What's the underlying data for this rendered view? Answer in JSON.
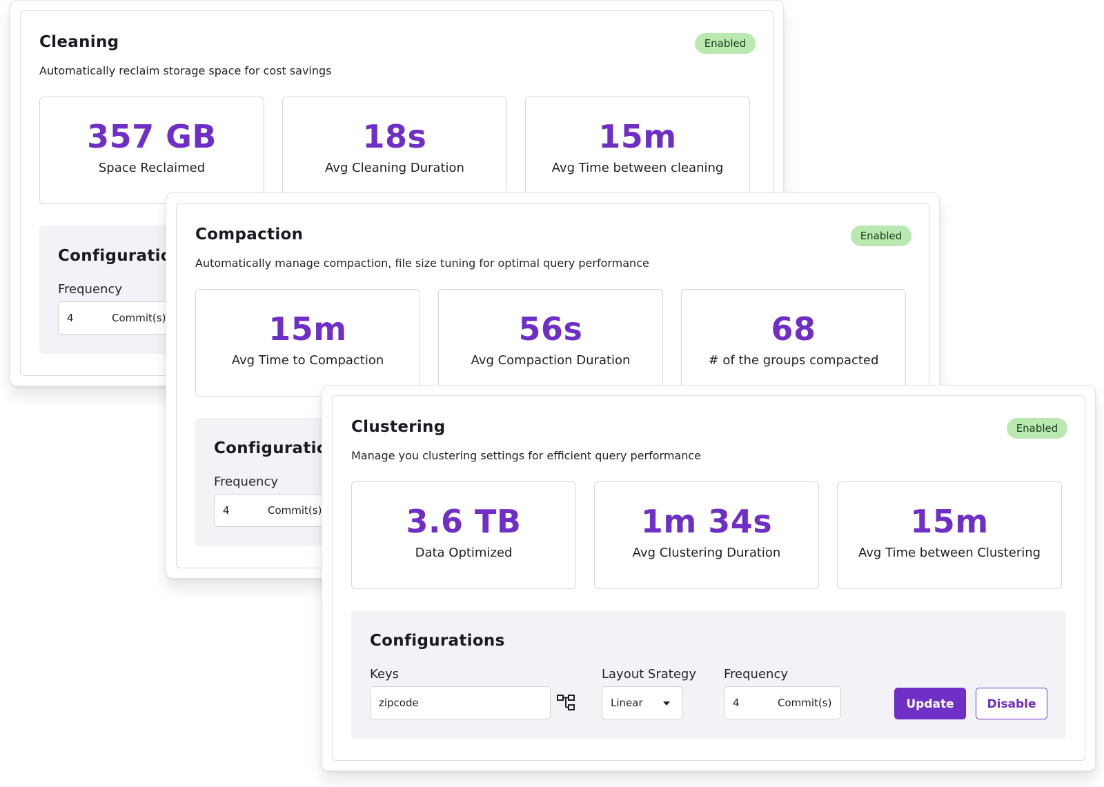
{
  "cleaning": {
    "title": "Cleaning",
    "badge": "Enabled",
    "description": "Automatically reclaim storage space for cost savings",
    "stats": [
      {
        "value": "357 GB",
        "label": "Space Reclaimed"
      },
      {
        "value": "18s",
        "label": "Avg Cleaning Duration"
      },
      {
        "value": "15m",
        "label": "Avg Time between cleaning"
      }
    ],
    "config": {
      "title": "Configurations",
      "frequency_label": "Frequency",
      "frequency_value": "4",
      "frequency_unit": "Commit(s)"
    }
  },
  "compaction": {
    "title": "Compaction",
    "badge": "Enabled",
    "description": "Automatically manage compaction, file size tuning for optimal query performance",
    "stats": [
      {
        "value": "15m",
        "label": "Avg Time to Compaction"
      },
      {
        "value": "56s",
        "label": "Avg Compaction Duration"
      },
      {
        "value": "68",
        "label": "# of the groups compacted"
      }
    ],
    "config": {
      "title": "Configurations",
      "frequency_label": "Frequency",
      "frequency_value": "4",
      "frequency_unit": "Commit(s)"
    }
  },
  "clustering": {
    "title": "Clustering",
    "badge": "Enabled",
    "description": "Manage you clustering settings for efficient query performance",
    "stats": [
      {
        "value": "3.6 TB",
        "label": "Data Optimized"
      },
      {
        "value": "1m 34s",
        "label": "Avg Clustering Duration"
      },
      {
        "value": "15m",
        "label": "Avg Time between Clustering"
      }
    ],
    "config": {
      "title": "Configurations",
      "keys_label": "Keys",
      "keys_value": "zipcode",
      "layout_label": "Layout Srategy",
      "layout_value": "Linear",
      "frequency_label": "Frequency",
      "frequency_value": "4",
      "frequency_unit": "Commit(s)",
      "update_label": "Update",
      "disable_label": "Disable"
    }
  },
  "colors": {
    "accent": "#6f2fc6",
    "badge_bg": "#b9e9b1",
    "config_bg": "#f3f3f7"
  },
  "icons": {
    "keys_picker": "tree-structure-icon",
    "layout_dropdown": "caret-down-icon"
  }
}
